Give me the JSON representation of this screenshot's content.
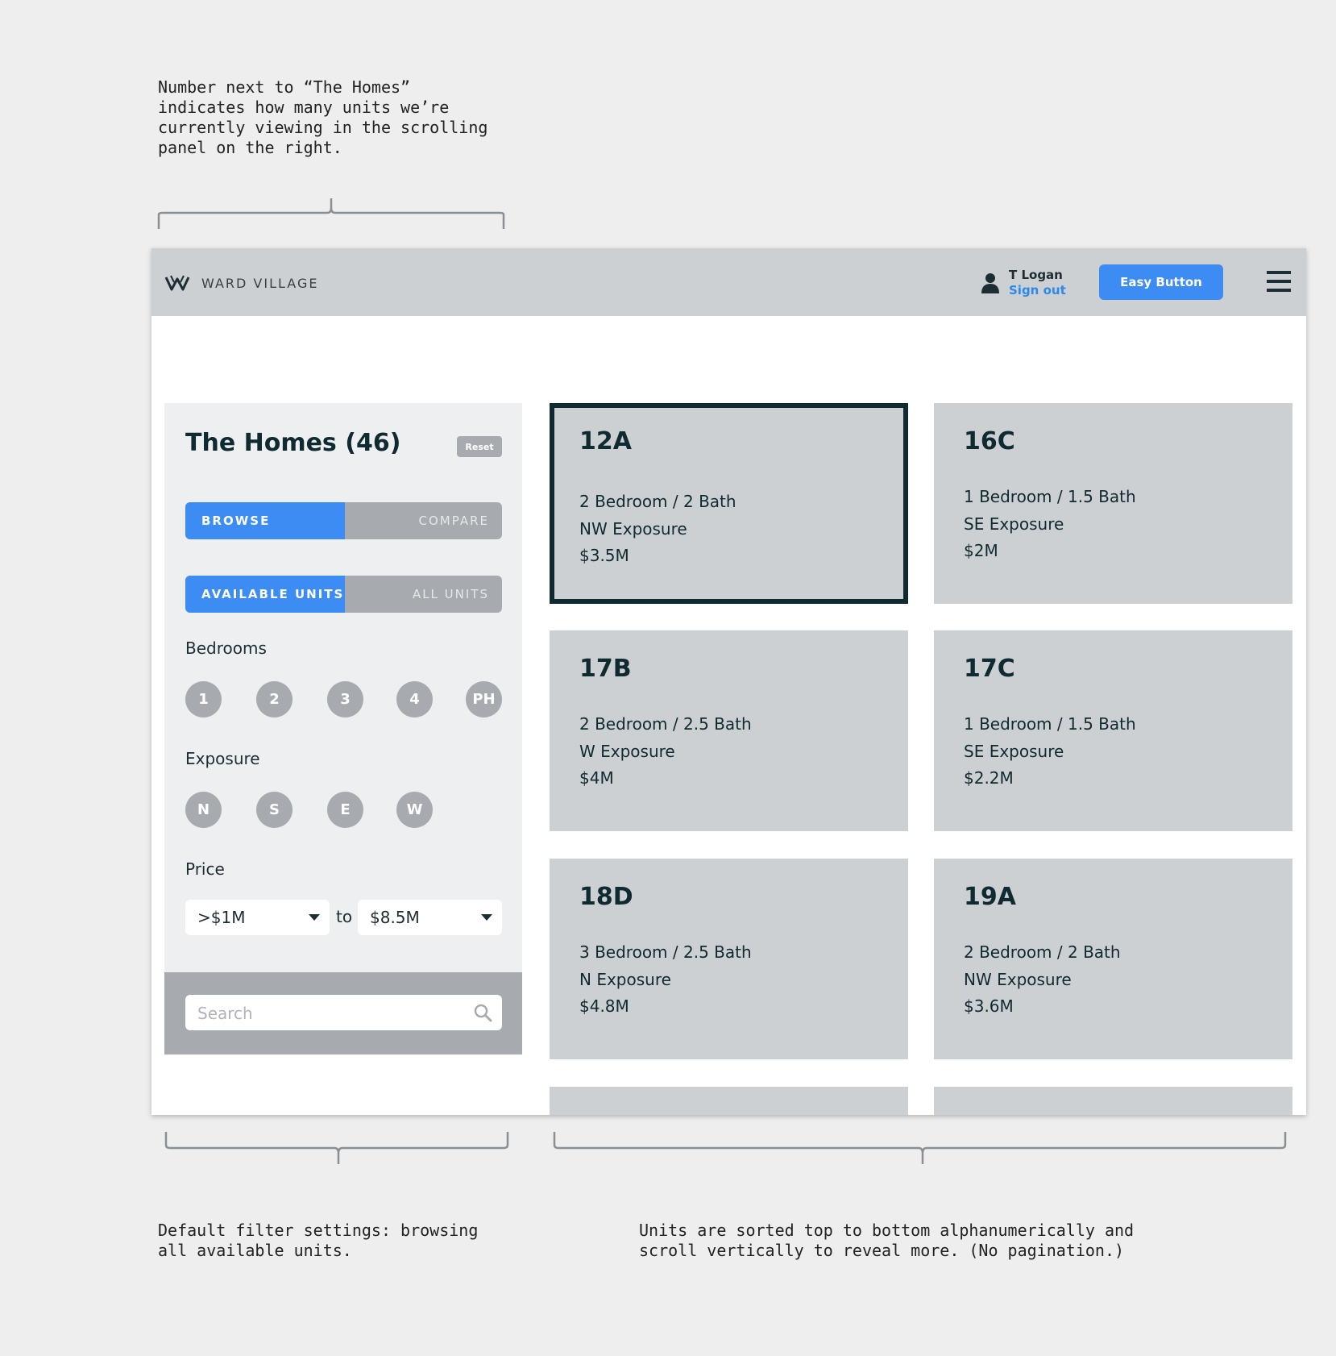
{
  "annotations": {
    "top": "Number next to “The Homes”\nindicates how many units we’re\ncurrently viewing in the scrolling\npanel on the right.",
    "bottom_left": "Default filter settings: browsing\nall available units.",
    "bottom_right": "Units are sorted top to bottom alphanumerically and\nscroll vertically to reveal more. (No pagination.)"
  },
  "header": {
    "logo_text": "WARD VILLAGE",
    "logo_icon": "ward-village-logo-icon",
    "user_name": "T Logan",
    "sign_out": "Sign out",
    "easy_button": "Easy Button",
    "menu_icon": "hamburger-menu-icon"
  },
  "sidebar": {
    "title": "The Homes (46)",
    "reset": "Reset",
    "mode_toggle": {
      "active": "BROWSE",
      "inactive": "COMPARE"
    },
    "units_toggle": {
      "active": "AVAILABLE UNITS",
      "inactive": "ALL UNITS"
    },
    "bedrooms_label": "Bedrooms",
    "bedrooms": [
      "1",
      "2",
      "3",
      "4",
      "PH"
    ],
    "exposure_label": "Exposure",
    "exposure": [
      "N",
      "S",
      "E",
      "W"
    ],
    "price_label": "Price",
    "price_min": ">$1M",
    "price_to": "to",
    "price_max": "$8.5M",
    "search_placeholder": "Search"
  },
  "units": [
    {
      "unit": "12A",
      "rooms": "2 Bedroom / 2 Bath",
      "exposure": "NW Exposure",
      "price": "$3.5M",
      "selected": true
    },
    {
      "unit": "16C",
      "rooms": "1 Bedroom / 1.5 Bath",
      "exposure": "SE Exposure",
      "price": "$2M"
    },
    {
      "unit": "17B",
      "rooms": "2 Bedroom / 2.5 Bath",
      "exposure": "W Exposure",
      "price": "$4M"
    },
    {
      "unit": "17C",
      "rooms": "1 Bedroom / 1.5 Bath",
      "exposure": "SE Exposure",
      "price": "$2.2M"
    },
    {
      "unit": "18D",
      "rooms": "3 Bedroom / 2.5 Bath",
      "exposure": "N Exposure",
      "price": "$4.8M"
    },
    {
      "unit": "19A",
      "rooms": "2 Bedroom / 2 Bath",
      "exposure": "NW Exposure",
      "price": "$3.6M"
    }
  ],
  "colors": {
    "accent": "#3c8cf4",
    "link": "#2b8ae8",
    "dark_text": "#0f2a30",
    "card_bg": "#cdd0d3",
    "chip_bg": "#a7abaf"
  }
}
